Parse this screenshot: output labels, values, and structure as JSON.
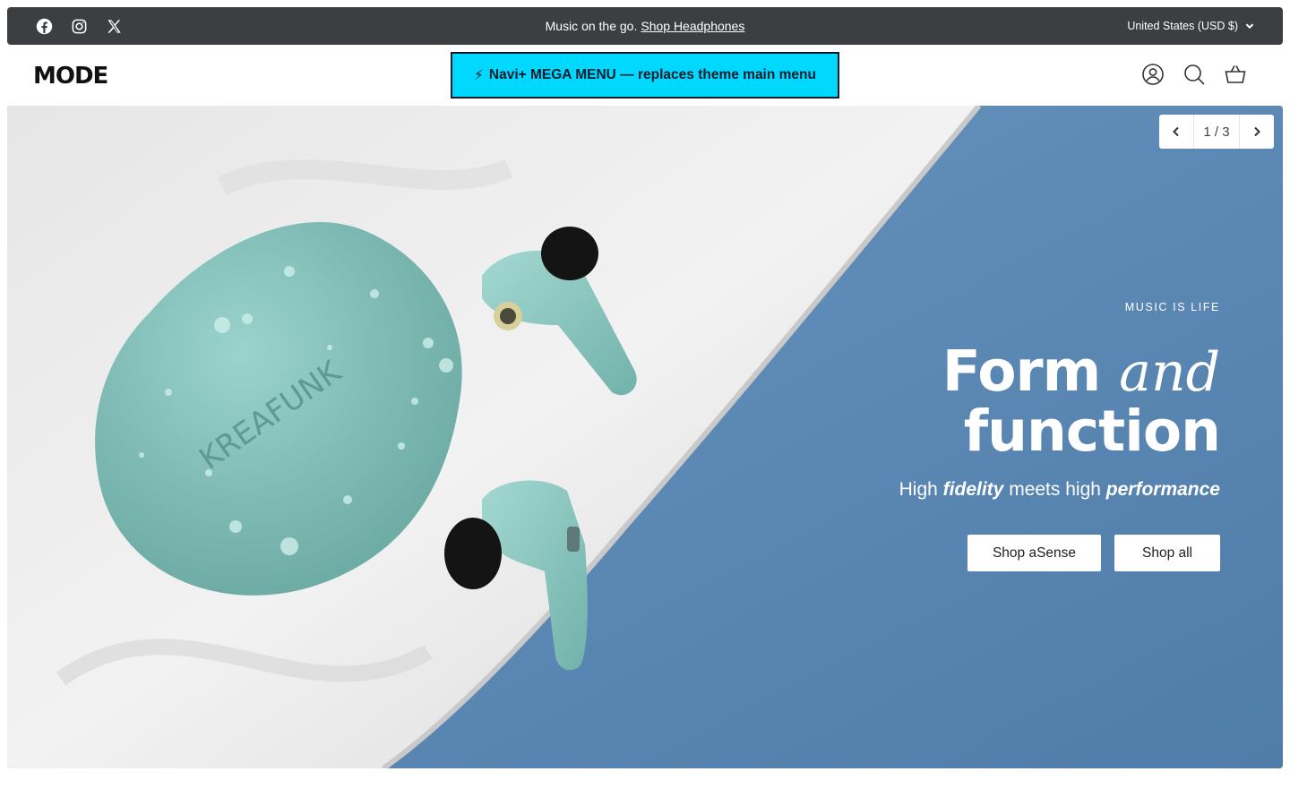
{
  "announcement": {
    "message": "Music on the go.",
    "link_label": "Shop Headphones",
    "currency_label": "United States (USD $)",
    "social_icons": [
      "facebook-icon",
      "instagram-icon",
      "x-icon"
    ]
  },
  "header": {
    "logo": "MODE",
    "mega_menu_icon": "⚡",
    "mega_menu_label": "Navi+ MEGA MENU — replaces theme main menu",
    "icons": [
      "account-icon",
      "search-icon",
      "cart-icon"
    ]
  },
  "hero": {
    "product_brand": "KREAFUNK",
    "slide_counter": "1 / 3",
    "eyebrow": "MUSIC IS LIFE",
    "headline_part1": "Form",
    "headline_italic": "and",
    "headline_part2": "function",
    "subhead_1": "High",
    "subhead_em1": "fidelity",
    "subhead_2": "meets high",
    "subhead_em2": "performance",
    "button_primary": "Shop aSense",
    "button_secondary": "Shop all"
  },
  "colors": {
    "announcement_bg": "#3b3f42",
    "mega_menu_bg": "#00d8ff",
    "hero_blue": "#5b87b1",
    "product_teal": "#86c6bf"
  }
}
